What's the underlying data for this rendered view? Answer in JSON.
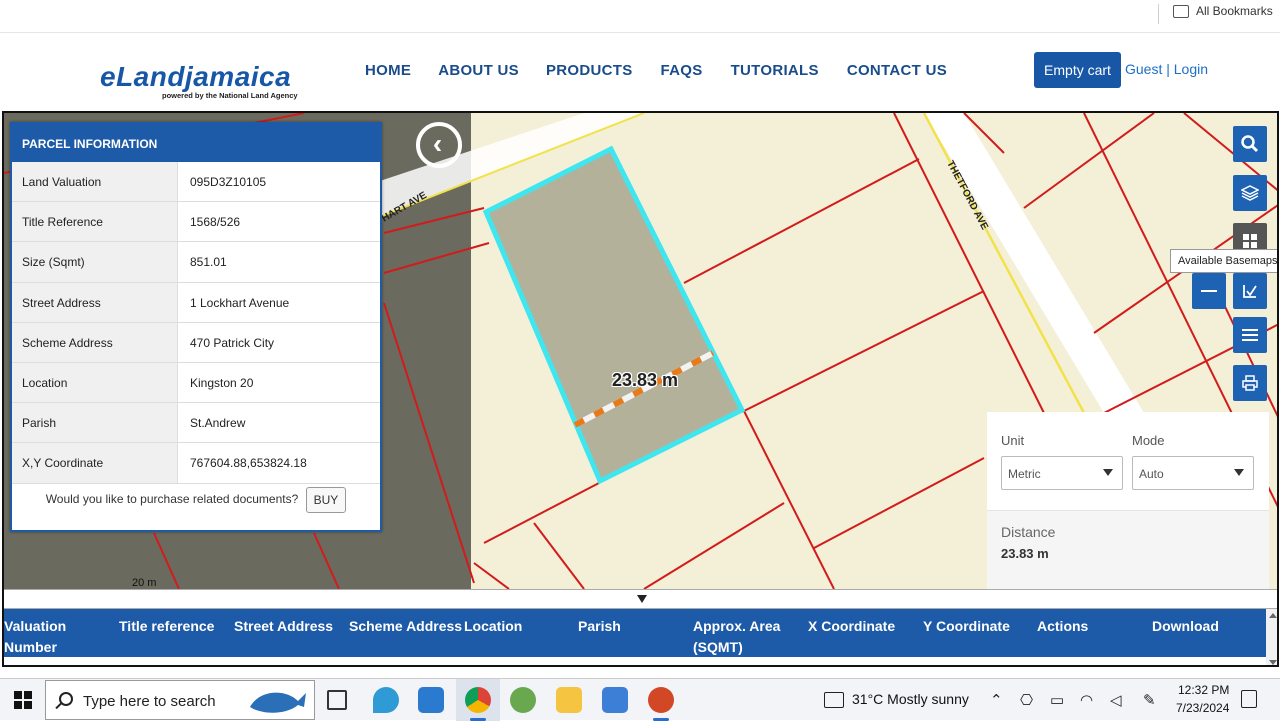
{
  "browser": {
    "bookmarks_label": "All Bookmarks"
  },
  "header": {
    "logo_text": "eLandjamaica",
    "logo_subtitle": "powered by the National Land Agency",
    "nav": [
      "HOME",
      "ABOUT US",
      "PRODUCTS",
      "FAQS",
      "TUTORIALS",
      "CONTACT US"
    ],
    "cart_label": "Empty cart",
    "login_label": "Guest | Login"
  },
  "parcel": {
    "title": "PARCEL INFORMATION",
    "rows": [
      {
        "key": "Land Valuation",
        "value": "095D3Z10105"
      },
      {
        "key": "Title Reference",
        "value": "1568/526"
      },
      {
        "key": "Size (Sqmt)",
        "value": "851.01"
      },
      {
        "key": "Street Address",
        "value": "1 Lockhart Avenue"
      },
      {
        "key": "Scheme Address",
        "value": "470 Patrick City"
      },
      {
        "key": "Location",
        "value": "Kingston 20"
      },
      {
        "key": "Parish",
        "value": "St.Andrew"
      },
      {
        "key": "X,Y Coordinate",
        "value": "767604.88,653824.18"
      }
    ],
    "purchase_prompt": "Would you like to purchase related documents?",
    "buy_label": "BUY"
  },
  "map": {
    "measure_label": "23.83 m",
    "street_1": "HART AVE",
    "street_2": "THETFORD AVE",
    "scale_label": "20 m",
    "tooltip": "Available Basemaps",
    "colors": {
      "parcel_line": "#d21b1b",
      "selected_outline": "#3fe6f0",
      "selected_fill": "#b3b19a",
      "map_bg": "#f4efd7",
      "road_edge": "#f2e24a",
      "tool_blue": "#1e62b3"
    }
  },
  "measure_panel": {
    "unit_label": "Unit",
    "mode_label": "Mode",
    "unit_value": "Metric",
    "mode_value": "Auto",
    "distance_label": "Distance",
    "distance_value": "23.83 m"
  },
  "results": {
    "columns": [
      "Valuation Number",
      "Title reference",
      "Street Address",
      "Scheme Address",
      "Location",
      "Parish",
      "Approx. Area (SQMT)",
      "X Coordinate",
      "Y Coordinate",
      "Actions",
      "Download"
    ]
  },
  "taskbar": {
    "search_placeholder": "Type here to search",
    "weather": "31°C  Mostly sunny",
    "time": "12:32 PM",
    "date": "7/23/2024"
  }
}
